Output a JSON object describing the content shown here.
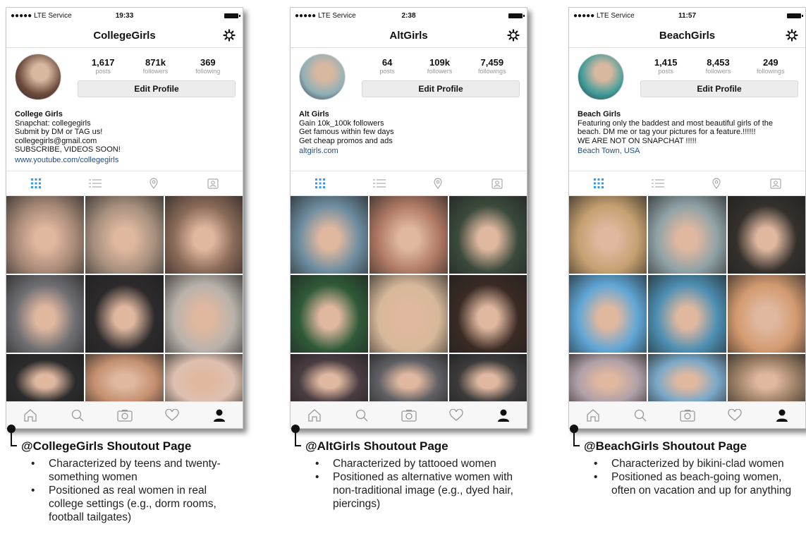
{
  "panels": [
    {
      "status": {
        "carrier": "●●●●● LTE Service",
        "time": "19:33"
      },
      "title": "CollegeGirls",
      "stats": [
        {
          "num": "1,617",
          "label": "posts"
        },
        {
          "num": "871k",
          "label": "followers"
        },
        {
          "num": "369",
          "label": "following"
        }
      ],
      "edit_label": "Edit Profile",
      "bio": {
        "name": "College Girls",
        "lines": [
          "Snapchat: collegegirls",
          "Submit by DM or TAG us!",
          "collegegirls@gmail.com",
          "SUBSCRIBE, VIDEOS SOON!"
        ],
        "link": "www.youtube.com/collegegirls"
      },
      "caption": {
        "title": "@CollegeGirls Shoutout Page",
        "bullets": [
          "Characterized by teens and twenty-something women",
          "Positioned as real women in real college settings (e.g., dorm rooms, football tailgates)"
        ]
      }
    },
    {
      "status": {
        "carrier": "●●●●● LTE Service",
        "time": "2:38"
      },
      "title": "AltGirls",
      "stats": [
        {
          "num": "64",
          "label": "posts"
        },
        {
          "num": "109k",
          "label": "followers"
        },
        {
          "num": "7,459",
          "label": "followings"
        }
      ],
      "edit_label": "Edit Profile",
      "bio": {
        "name": "Alt Girls",
        "lines": [
          "Gain 10k_100k followers",
          "Get famous within few days",
          "Get cheap promos and ads"
        ],
        "link": "altgirls.com"
      },
      "caption": {
        "title": "@AltGirls Shoutout Page",
        "bullets": [
          "Characterized by tattooed women",
          "Positioned as alternative women with non-traditional image (e.g., dyed hair, piercings)"
        ]
      }
    },
    {
      "status": {
        "carrier": "●●●●● LTE Service",
        "time": "11:57"
      },
      "title": "BeachGirls",
      "stats": [
        {
          "num": "1,415",
          "label": "posts"
        },
        {
          "num": "8,453",
          "label": "followers"
        },
        {
          "num": "249",
          "label": "followings"
        }
      ],
      "edit_label": "Edit Profile",
      "bio": {
        "name": "Beach Girls",
        "lines": [
          "Featuring only the baddest and most beautiful girls of the beach. DM me or tag your pictures for a feature.!!!!!!",
          "WE ARE NOT ON SNAPCHAT !!!!!"
        ],
        "link": "Beach Town, USA"
      },
      "caption": {
        "title": "@BeachGirls Shoutout Page",
        "bullets": [
          "Characterized by bikini-clad women",
          "Positioned as beach-going women, often on vacation and up for anything"
        ]
      }
    }
  ],
  "colors": {
    "accent": "#3897f0",
    "link": "#1f4e8a",
    "tab_inactive": "#aaaaaa"
  },
  "photo_colors": [
    [
      "#a88a78",
      "#a7907e",
      "#8a6a58",
      "#6f6e73",
      "#2d2a2b",
      "#b9b2ab",
      "#2b2b2b",
      "#c49070",
      "#ddc0b0"
    ],
    [
      "#6d8da0",
      "#b07a65",
      "#3b4a3c",
      "#2f5a38",
      "#d7b89a",
      "#3a2a24",
      "#4a3d42",
      "#5e5e64",
      "#3c3a3a"
    ],
    [
      "#c5a070",
      "#8fa2a6",
      "#34302c",
      "#5fa6d6",
      "#4d8fb3",
      "#d39a70",
      "#b0a0a8",
      "#7aa8c8",
      "#9c8066"
    ]
  ],
  "avatar_colors": [
    "#6b4a3c",
    "#8fb0b8",
    "#3f9c9a"
  ]
}
